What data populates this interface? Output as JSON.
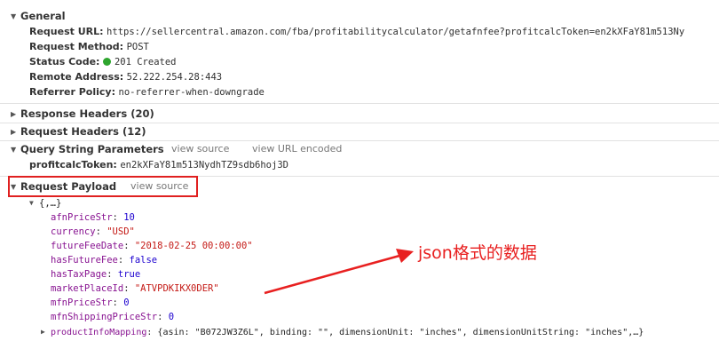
{
  "general": {
    "title": "General",
    "request_url_label": "Request URL:",
    "request_url": "https://sellercentral.amazon.com/fba/profitabilitycalculator/getafnfee?profitcalcToken=en2kXFaY81m513Ny",
    "method_label": "Request Method:",
    "method": "POST",
    "status_label": "Status Code:",
    "status": "201 Created",
    "status_color": "#2ea52e",
    "remote_label": "Remote Address:",
    "remote": "52.222.254.28:443",
    "referrer_label": "Referrer Policy:",
    "referrer": "no-referrer-when-downgrade"
  },
  "response_headers": {
    "title": "Response Headers (20)"
  },
  "request_headers": {
    "title": "Request Headers (12)"
  },
  "query_params": {
    "title": "Query String Parameters",
    "view_source": "view source",
    "view_url_encoded": "view URL encoded",
    "token_label": "profitcalcToken:",
    "token": "en2kXFaY81m513NydhTZ9sdb6hoj3D"
  },
  "payload": {
    "title": "Request Payload",
    "view_source": "view source",
    "root": "{,…}",
    "fields": [
      {
        "key": "afnPriceStr",
        "value": "10",
        "type": "num"
      },
      {
        "key": "currency",
        "value": "\"USD\"",
        "type": "str"
      },
      {
        "key": "futureFeeDate",
        "value": "\"2018-02-25 00:00:00\"",
        "type": "str"
      },
      {
        "key": "hasFutureFee",
        "value": "false",
        "type": "num"
      },
      {
        "key": "hasTaxPage",
        "value": "true",
        "type": "num"
      },
      {
        "key": "marketPlaceId",
        "value": "\"ATVPDKIKX0DER\"",
        "type": "str"
      },
      {
        "key": "mfnPriceStr",
        "value": "0",
        "type": "num"
      },
      {
        "key": "mfnShippingPriceStr",
        "value": "0",
        "type": "num"
      }
    ],
    "product_key": "productInfoMapping",
    "product_value": "{asin: \"B072JW3Z6L\", binding: \"\", dimensionUnit: \"inches\", dimensionUnitString: \"inches\",…}"
  },
  "annotation": {
    "text": "json格式的数据",
    "color": "#e82020"
  },
  "icons": {
    "expanded": "triangle-down-icon",
    "collapsed": "triangle-right-icon"
  }
}
